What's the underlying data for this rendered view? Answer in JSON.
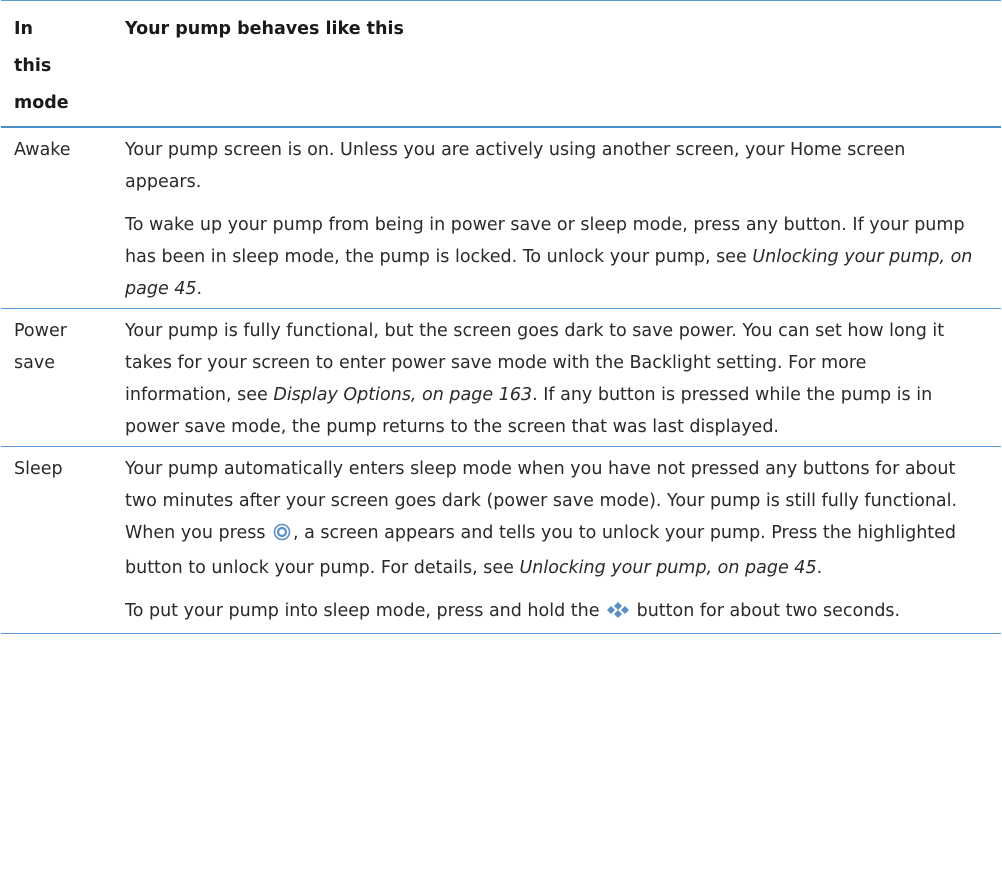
{
  "table": {
    "header": {
      "mode": "In this mode",
      "behavior": "Your pump behaves like this"
    },
    "rows": [
      {
        "mode": "Awake",
        "p1": "Your pump screen is on. Unless you are actively using another screen, your Home screen appears.",
        "p2_a": "To wake up your pump from being in power save or sleep mode, press any button. If your pump has been in sleep mode, the pump is locked. To unlock your pump, see ",
        "p2_xref": "Unlocking your pump, on page 45",
        "p2_b": "."
      },
      {
        "mode": "Power save",
        "p1_a": "Your pump is fully functional, but the screen goes dark to save power. You can set how long it takes for your screen to enter power save mode with the Backlight setting. For more information, see ",
        "p1_xref": "Display Options, on page 163",
        "p1_b": ". If any button is pressed while the pump is in power save mode, the pump returns to the screen that was last displayed."
      },
      {
        "mode": "Sleep",
        "p1_a": "Your pump automatically enters sleep mode when you have not pressed any buttons for about two minutes after your screen goes dark (power save mode). Your pump is still fully functional. When you press ",
        "p1_icon": "select-button-icon",
        "p1_b": ", a screen appears and tells you to unlock your pump. Press the highlighted button to unlock your pump. For details, see ",
        "p1_xref": "Unlocking your pump, on page 45",
        "p1_c": ".",
        "p2_a": "To put your pump into sleep mode, press and hold the ",
        "p2_icon": "menu-button-icon",
        "p2_b": " button for about two seconds."
      }
    ]
  },
  "colors": {
    "rule": "#5b9bd5",
    "header_rule": "#4a90c8",
    "icon": "#5b8fc7"
  }
}
